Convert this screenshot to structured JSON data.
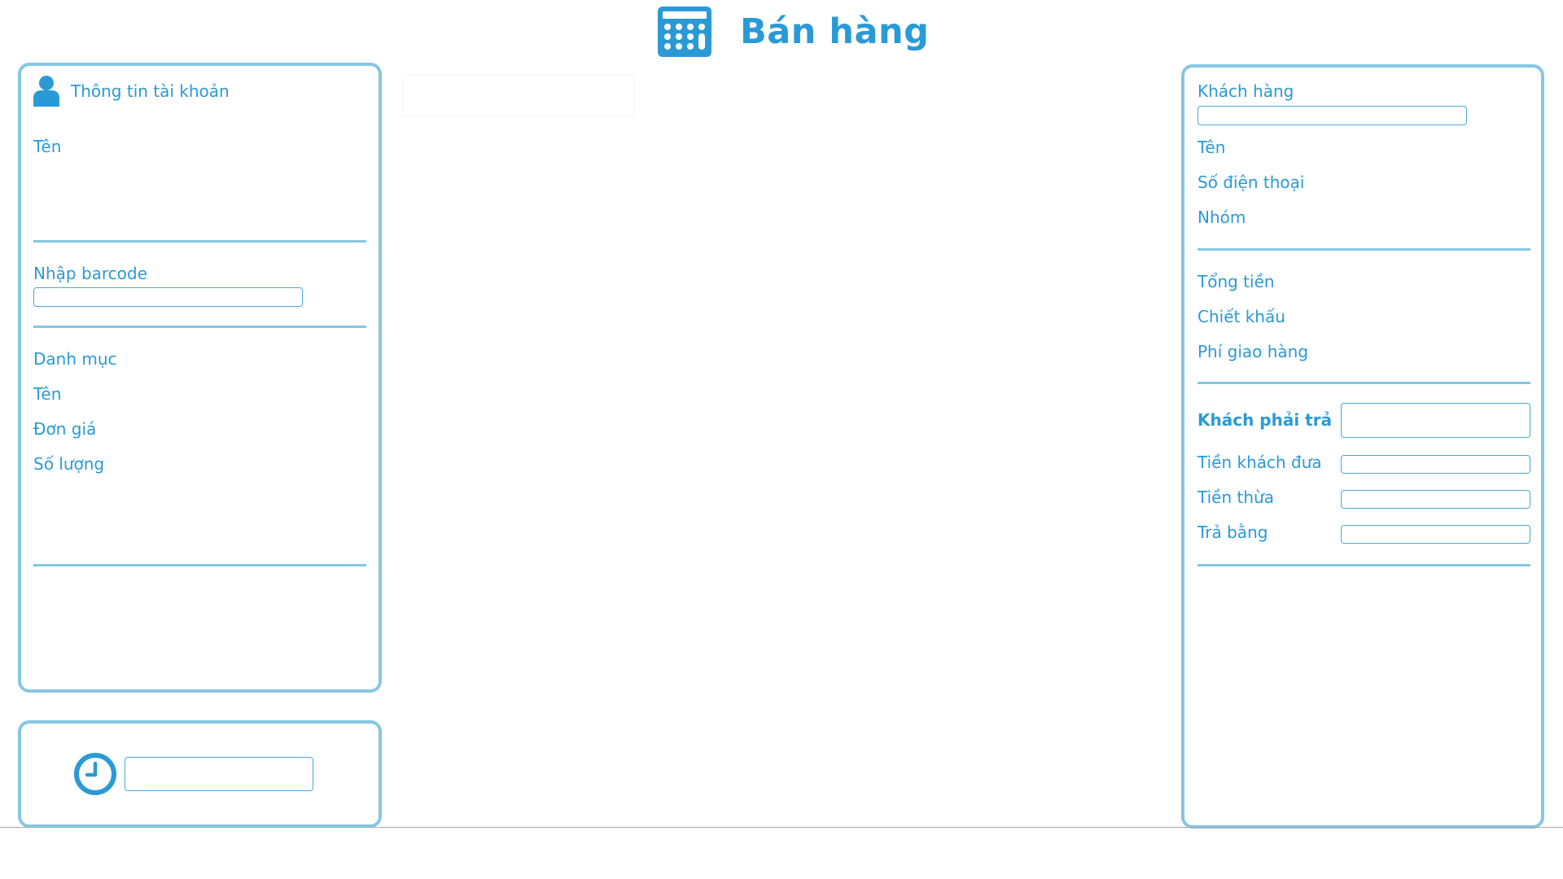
{
  "header": {
    "icon": "calculator-icon",
    "title": "Bán hàng"
  },
  "account": {
    "icon": "user-icon",
    "title": "Thông tin tài khoản",
    "name_label": "Tên"
  },
  "barcode": {
    "label": "Nhập barcode",
    "value": ""
  },
  "product": {
    "category_label": "Danh mục",
    "name_label": "Tên",
    "price_label": "Đơn giá",
    "quantity_label": "Số lượng"
  },
  "clock": {
    "icon": "clock-icon",
    "value": ""
  },
  "customer": {
    "label": "Khách hàng",
    "search_value": "",
    "name_label": "Tên",
    "phone_label": "Số điện thoại",
    "group_label": "Nhóm"
  },
  "totals": {
    "total_label": "Tổng tiền",
    "discount_label": "Chiết khấu",
    "shipping_label": "Phí giao hàng"
  },
  "payment": {
    "due_label": "Khách phải trả",
    "paid_label": "Tiền khách đưa",
    "change_label": "Tiền thừa",
    "method_label": "Trả bằng",
    "due_value": "",
    "paid_value": "",
    "change_value": "",
    "method_value": ""
  },
  "colors": {
    "accent": "#2a9ad6",
    "border": "#86c6e4"
  }
}
